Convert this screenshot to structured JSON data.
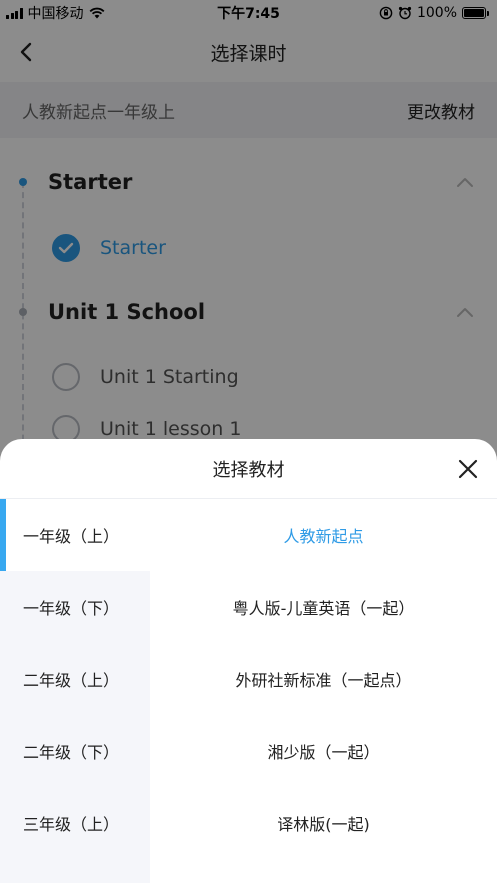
{
  "status_bar": {
    "carrier": "中国移动",
    "time": "下午7:45",
    "battery": "100%"
  },
  "nav": {
    "title": "选择课时"
  },
  "book_header": {
    "name": "人教新起点一年级上",
    "change_label": "更改教材"
  },
  "units": [
    {
      "title": "Starter",
      "lessons": [
        {
          "label": "Starter",
          "checked": true
        }
      ]
    },
    {
      "title": "Unit 1 School",
      "lessons": [
        {
          "label": "Unit 1 Starting",
          "checked": false
        },
        {
          "label": "Unit 1 lesson 1",
          "checked": false
        }
      ]
    }
  ],
  "sheet": {
    "title": "选择教材",
    "grades": [
      "一年级（上）",
      "一年级（下）",
      "二年级（上）",
      "二年级（下）",
      "三年级（上）"
    ],
    "books": [
      "人教新起点",
      "粤人版-儿童英语（一起）",
      "外研社新标准（一起点）",
      "湘少版（一起）",
      "译林版(一起)"
    ]
  },
  "colors": {
    "accent": "#2f9be6",
    "sidebar_bg": "#f5f6fa",
    "header_bg": "#f2f3f6"
  },
  "icons": {
    "back": "chevron-left-icon",
    "close": "close-icon",
    "collapse": "chevron-up-icon",
    "check": "check-icon"
  }
}
